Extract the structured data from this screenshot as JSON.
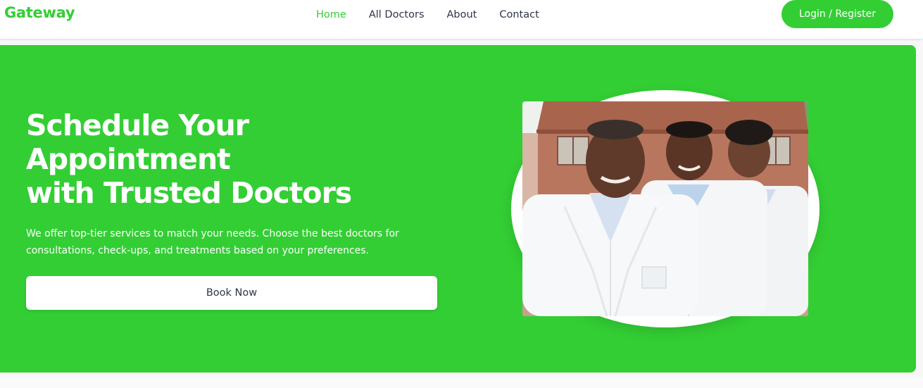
{
  "brand": {
    "name": "Gateway"
  },
  "nav": {
    "links": [
      {
        "label": "Home",
        "active": true
      },
      {
        "label": "All Doctors",
        "active": false
      },
      {
        "label": "About",
        "active": false
      },
      {
        "label": "Contact",
        "active": false
      }
    ],
    "login_label": "Login / Register"
  },
  "hero": {
    "title_lines": [
      "Schedule Your",
      "Appointment",
      "with Trusted Doctors"
    ],
    "description_lines": [
      "We offer top-tier services to match your needs. Choose the best doctors for",
      "consultations, check-ups, and treatments based on your preferences."
    ],
    "cta_label": "Book Now"
  },
  "colors": {
    "accent": "#33ce34",
    "text_dark": "#2f3548",
    "white": "#ffffff"
  },
  "icons": {
    "hero_image": "doctors-photo"
  }
}
